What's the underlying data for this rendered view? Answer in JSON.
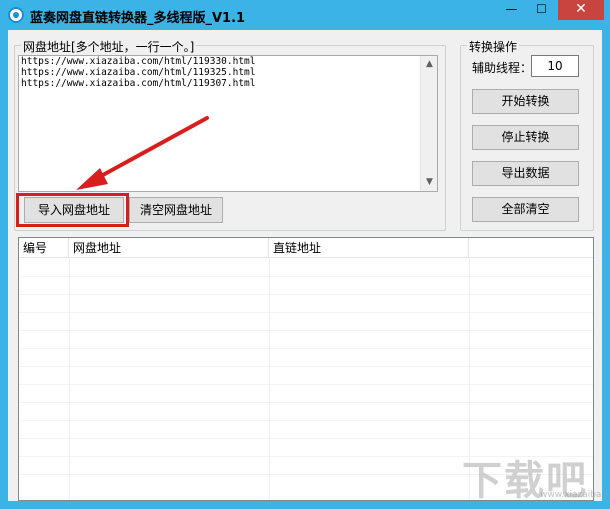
{
  "window": {
    "title": "蓝奏网盘直链转换器_多线程版_V1.1",
    "minimize_glyph": "—",
    "maximize_glyph": "☐",
    "close_glyph": "✕"
  },
  "url_group": {
    "title": "网盘地址[多个地址，一行一个。]",
    "lines": [
      "https://www.xiazaiba.com/html/119330.html",
      "https://www.xiazaiba.com/html/119325.html",
      "https://www.xiazaiba.com/html/119307.html"
    ],
    "import_button": "导入网盘地址",
    "clear_button": "清空网盘地址"
  },
  "ops_group": {
    "title": "转换操作",
    "thread_label": "辅助线程：",
    "thread_value": "10",
    "start_button": "开始转换",
    "stop_button": "停止转换",
    "export_button": "导出数据",
    "clear_all_button": "全部清空"
  },
  "table": {
    "columns": [
      "编号",
      "网盘地址",
      "直链地址"
    ]
  },
  "watermark": {
    "text": "下载吧",
    "sub": "www.xiazaiba.com"
  },
  "colors": {
    "titlebar": "#3bb3e6",
    "close_button": "#c7453e",
    "highlight": "#d81e1e"
  }
}
